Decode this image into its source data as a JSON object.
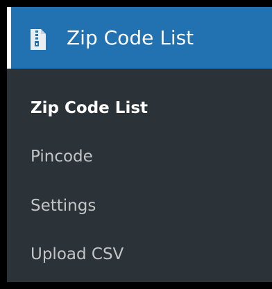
{
  "menu": {
    "header": {
      "title": "Zip Code List",
      "icon": "zip-file-icon"
    },
    "items": [
      {
        "label": "Zip Code List",
        "current": true
      },
      {
        "label": "Pincode",
        "current": false
      },
      {
        "label": "Settings",
        "current": false
      },
      {
        "label": "Upload CSV",
        "current": false
      }
    ]
  },
  "colors": {
    "sidebar_background": "#2c3338",
    "header_background": "#2271b1",
    "current_item_text": "#ffffff",
    "item_text": "#c3c4c7",
    "frame": "#000000"
  }
}
